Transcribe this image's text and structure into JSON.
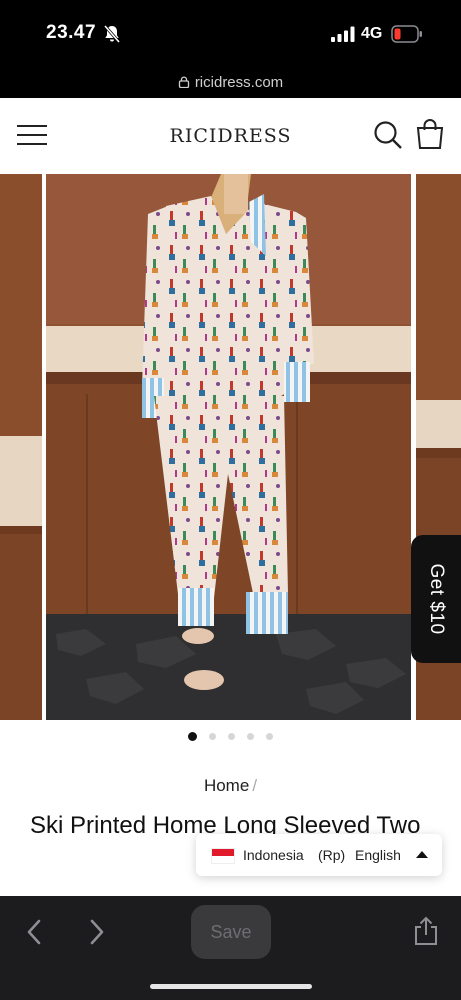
{
  "status_bar": {
    "time": "23.47",
    "network": "4G",
    "icons": [
      "bell-slash-icon",
      "signal-icon",
      "battery-low-icon"
    ]
  },
  "browser": {
    "url": "ricidress.com",
    "lock_icon": "lock-icon"
  },
  "header": {
    "logo": "RICIDRESS",
    "icons": [
      "hamburger-menu-icon",
      "search-icon",
      "shopping-bag-icon"
    ]
  },
  "gallery": {
    "promo_tab": "Get $10",
    "slide_count": 5,
    "active_slide": 1,
    "colors": {
      "wood": "#8a4e2c",
      "print_base": "#efe3da",
      "stripe": "#8fc3e6",
      "floor": "#2f2f31"
    }
  },
  "breadcrumb": {
    "home": "Home",
    "separator": "/"
  },
  "product": {
    "title": "Ski Printed Home Long Sleeved Two"
  },
  "localization": {
    "country": "Indonesia",
    "currency": "(Rp)",
    "language": "English",
    "flag_icon": "indonesia-flag-icon"
  },
  "toolbar": {
    "save_label": "Save",
    "icons": [
      "back-arrow-icon",
      "forward-arrow-icon",
      "share-icon"
    ]
  }
}
